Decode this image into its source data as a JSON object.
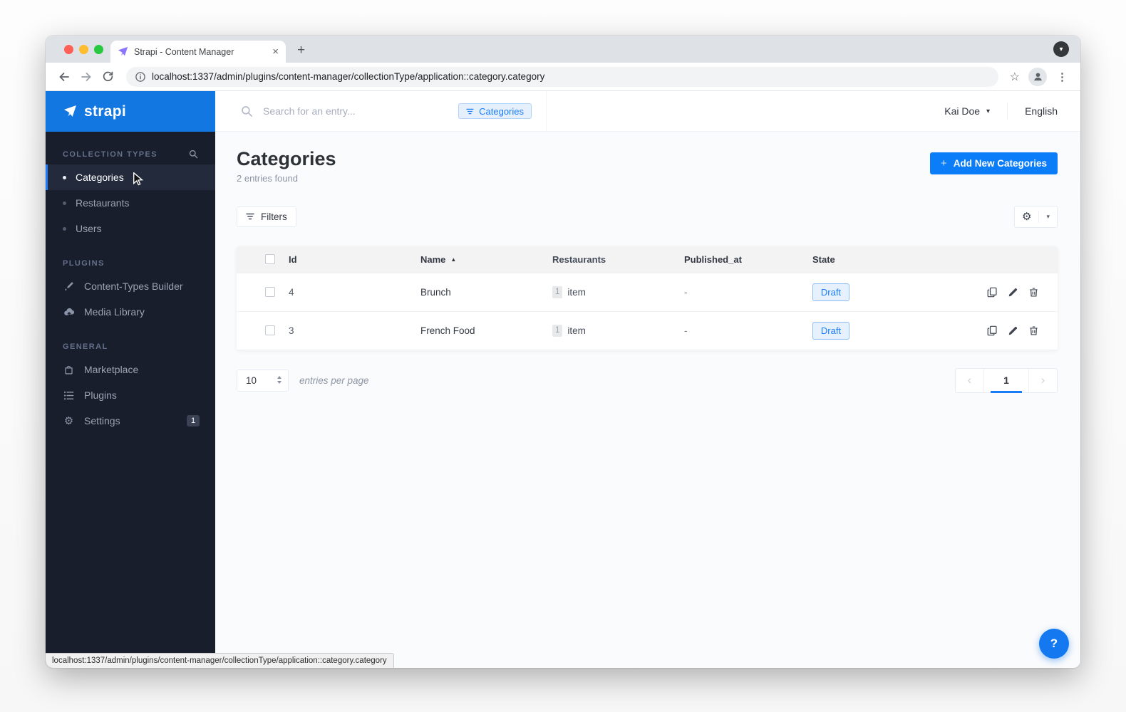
{
  "browser": {
    "tab_title": "Strapi - Content Manager",
    "url": "localhost:1337/admin/plugins/content-manager/collectionType/application::category.category",
    "status_url": "localhost:1337/admin/plugins/content-manager/collectionType/application::category.category"
  },
  "icons": {
    "close": "×",
    "plus": "+",
    "kebab": "⋮",
    "star": "☆",
    "caret_down": "▾",
    "chevron_left": "‹",
    "chevron_right": "›",
    "sort_asc": "▲",
    "gear": "⚙"
  },
  "sidebar": {
    "logo_text": "strapi",
    "sections": [
      {
        "title": "COLLECTION TYPES",
        "items": [
          {
            "label": "Categories",
            "active": true
          },
          {
            "label": "Restaurants",
            "active": false
          },
          {
            "label": "Users",
            "active": false
          }
        ]
      },
      {
        "title": "PLUGINS",
        "items": [
          {
            "label": "Content-Types Builder"
          },
          {
            "label": "Media Library"
          }
        ]
      },
      {
        "title": "GENERAL",
        "items": [
          {
            "label": "Marketplace"
          },
          {
            "label": "Plugins"
          },
          {
            "label": "Settings",
            "badge": "1"
          }
        ]
      }
    ]
  },
  "header": {
    "search_placeholder": "Search for an entry...",
    "filter_chip": "Categories",
    "user_name": "Kai Doe",
    "language": "English"
  },
  "page": {
    "title": "Categories",
    "subtitle": "2 entries found",
    "add_button_label": "Add New Categories",
    "filters_button_label": "Filters"
  },
  "table": {
    "columns": [
      "Id",
      "Name",
      "Restaurants",
      "Published_at",
      "State"
    ],
    "sorted_column": "Name",
    "rows": [
      {
        "id": "4",
        "name": "Brunch",
        "restaurants_count": "1",
        "restaurants_unit": "item",
        "published_at": "-",
        "state": "Draft"
      },
      {
        "id": "3",
        "name": "French Food",
        "restaurants_count": "1",
        "restaurants_unit": "item",
        "published_at": "-",
        "state": "Draft"
      }
    ]
  },
  "pagination": {
    "per_page": "10",
    "per_page_label": "entries per page",
    "current_page": "1"
  },
  "help": {
    "label": "?"
  },
  "colors": {
    "accent": "#007eff",
    "logo_bar": "#1277e1",
    "sidebar_bg": "#181e2b",
    "draft_bg": "#e7f1fd",
    "draft_text": "#1b7df5"
  }
}
